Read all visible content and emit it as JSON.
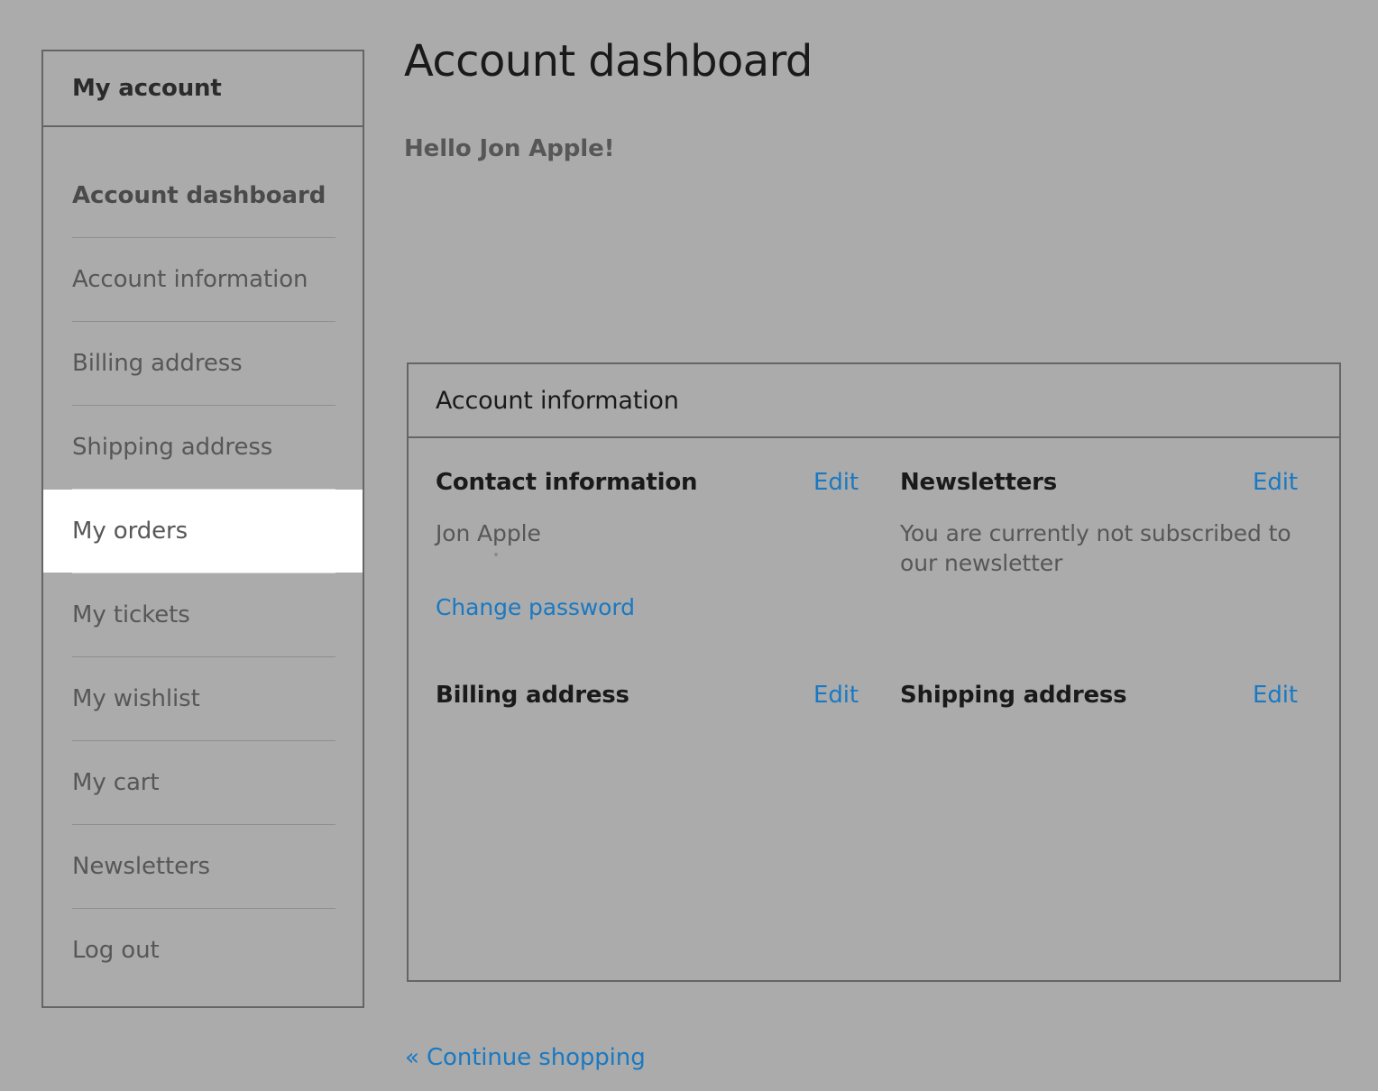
{
  "theme": {
    "page_background": "#ababab",
    "link_color": "#1979c3",
    "text_color": "#575757",
    "heading_color": "#1a1a1a",
    "border_color": "#656565",
    "active_item_background": "#ffffff"
  },
  "sidebar": {
    "header_title": "My account",
    "items": [
      {
        "label": "Account dashboard",
        "current": true,
        "active": false
      },
      {
        "label": "Account information",
        "current": false,
        "active": false
      },
      {
        "label": "Billing address",
        "current": false,
        "active": false
      },
      {
        "label": "Shipping address",
        "current": false,
        "active": false
      },
      {
        "label": "My orders",
        "current": false,
        "active": true
      },
      {
        "label": "My tickets",
        "current": false,
        "active": false
      },
      {
        "label": "My wishlist",
        "current": false,
        "active": false
      },
      {
        "label": "My cart",
        "current": false,
        "active": false
      },
      {
        "label": "Newsletters",
        "current": false,
        "active": false
      },
      {
        "label": "Log out",
        "current": false,
        "active": false
      }
    ]
  },
  "main": {
    "page_title": "Account dashboard",
    "greeting": "Hello Jon Apple!"
  },
  "panel": {
    "title": "Account information",
    "contact": {
      "title": "Contact information",
      "edit_label": "Edit",
      "name": "Jon Apple",
      "change_password_label": "Change password"
    },
    "newsletters": {
      "title": "Newsletters",
      "edit_label": "Edit",
      "status": "You are currently not subscribed to our newsletter"
    },
    "billing_address": {
      "title": "Billing address",
      "edit_label": "Edit",
      "content": ""
    },
    "shipping_address": {
      "title": "Shipping address",
      "edit_label": "Edit",
      "content": ""
    }
  },
  "footer": {
    "continue_shopping_label": "« Continue shopping"
  }
}
